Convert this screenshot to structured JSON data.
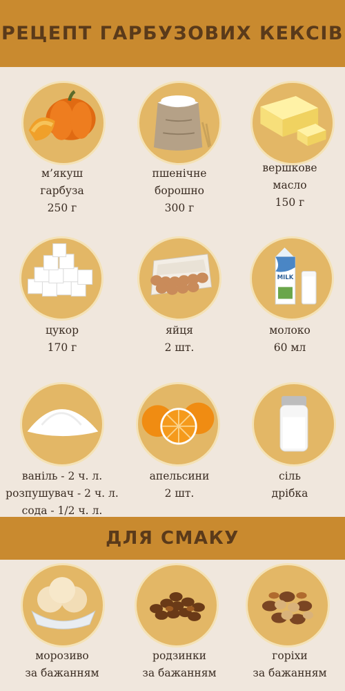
{
  "header": {
    "title": "РЕЦЕПТ ГАРБУЗОВИХ КЕКСІВ"
  },
  "ingredients": [
    {
      "name": "м’якуш",
      "name2": "гарбуза",
      "amount": "250 г",
      "icon": "pumpkin-icon"
    },
    {
      "name": "пшенічне",
      "name2": "борошно",
      "amount": "300 г",
      "icon": "flour-bag-icon"
    },
    {
      "name": "вершкове",
      "name2": "масло",
      "amount": "150 г",
      "icon": "butter-icon"
    },
    {
      "name": "цукор",
      "amount": "170 г",
      "icon": "sugar-cubes-icon"
    },
    {
      "name": "яйця",
      "amount": "2 шт.",
      "icon": "eggs-icon"
    },
    {
      "name": "молоко",
      "amount": "60 мл",
      "icon": "milk-icon"
    },
    {
      "line1": "ваніль - 2 ч. л.",
      "line2": "розпушувач - 2 ч. л.",
      "line3": "сода - 1/2 ч. л.",
      "icon": "powder-icon"
    },
    {
      "name": "апельсини",
      "amount": "2 шт.",
      "icon": "oranges-icon"
    },
    {
      "name": "сіль",
      "amount": "дрібка",
      "icon": "salt-shaker-icon"
    }
  ],
  "optional_section": {
    "title": "ДЛЯ СМАКУ"
  },
  "optional": [
    {
      "name": "морозиво",
      "amount": "за бажанням",
      "icon": "ice-cream-icon"
    },
    {
      "name": "родзинки",
      "amount": "за бажанням",
      "icon": "raisins-icon"
    },
    {
      "name": "горіхи",
      "amount": "за бажанням",
      "icon": "nuts-icon"
    }
  ]
}
